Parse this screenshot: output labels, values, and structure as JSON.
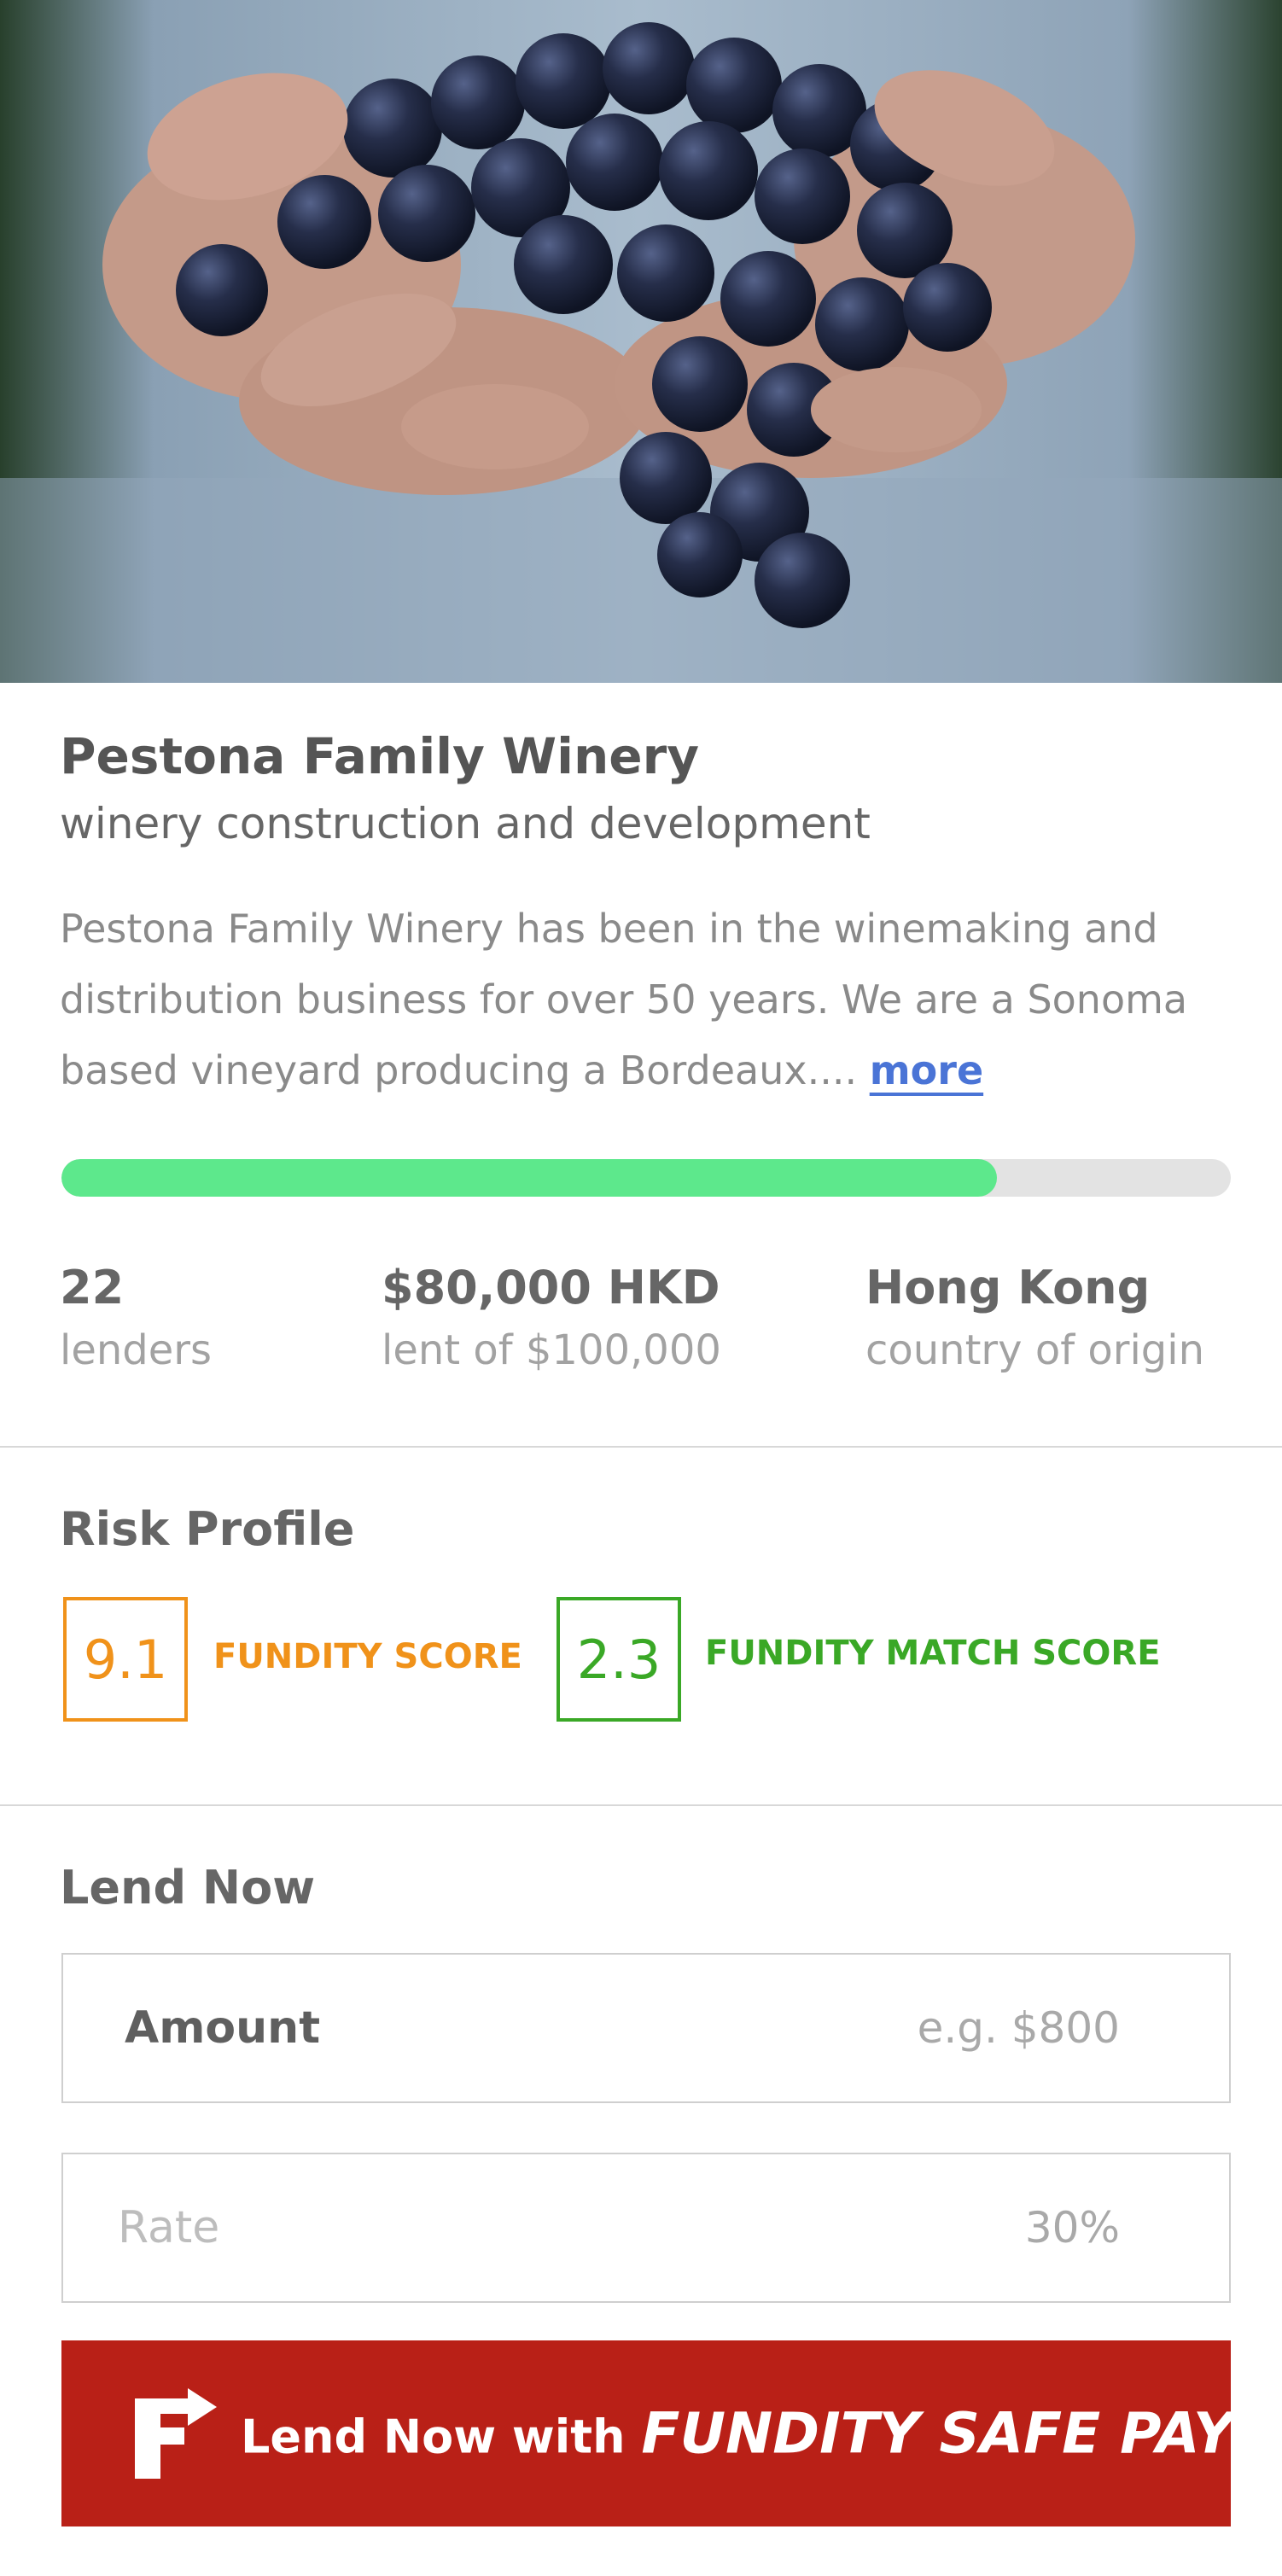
{
  "hero": {
    "image_description": "",
    "colors": {
      "shirt": "#9fb2c4",
      "grape": "#1f2740",
      "skin": "#c69a88"
    }
  },
  "project": {
    "title": "Pestona Family Winery",
    "subtitle": "winery construction and development",
    "description": "Pestona Family Winery has been in the winemaking and distribution business for over 50 years. We are a Sonoma based vineyard producing a Bordeaux....",
    "more_label": "more"
  },
  "funding": {
    "progress_fraction": 0.8,
    "progress_color": "#5de88c"
  },
  "stats": {
    "lenders_value": "22",
    "lenders_label": "lenders",
    "amount_value": "$80,000 HKD",
    "amount_label": "lent of $100,000",
    "origin_value": "Hong Kong",
    "origin_label": "country of origin"
  },
  "risk": {
    "section_title": "Risk Profile",
    "fundity_score": "9.1",
    "fundity_score_label": "FUNDITY SCORE",
    "fundity_score_color": "#f0921a",
    "match_score": "2.3",
    "match_score_label": "FUNDITY MATCH SCORE",
    "match_score_color": "#3aa826"
  },
  "lend": {
    "section_title": "Lend Now",
    "amount_label": "Amount",
    "amount_placeholder": "e.g. $800",
    "rate_label": "Rate",
    "rate_placeholder": "30%",
    "button_prefix": "Lend Now with",
    "button_brand": "FUNDITY SAFE PAY",
    "button_color": "#b92017",
    "logo_icon": "fundity-logo-icon"
  }
}
